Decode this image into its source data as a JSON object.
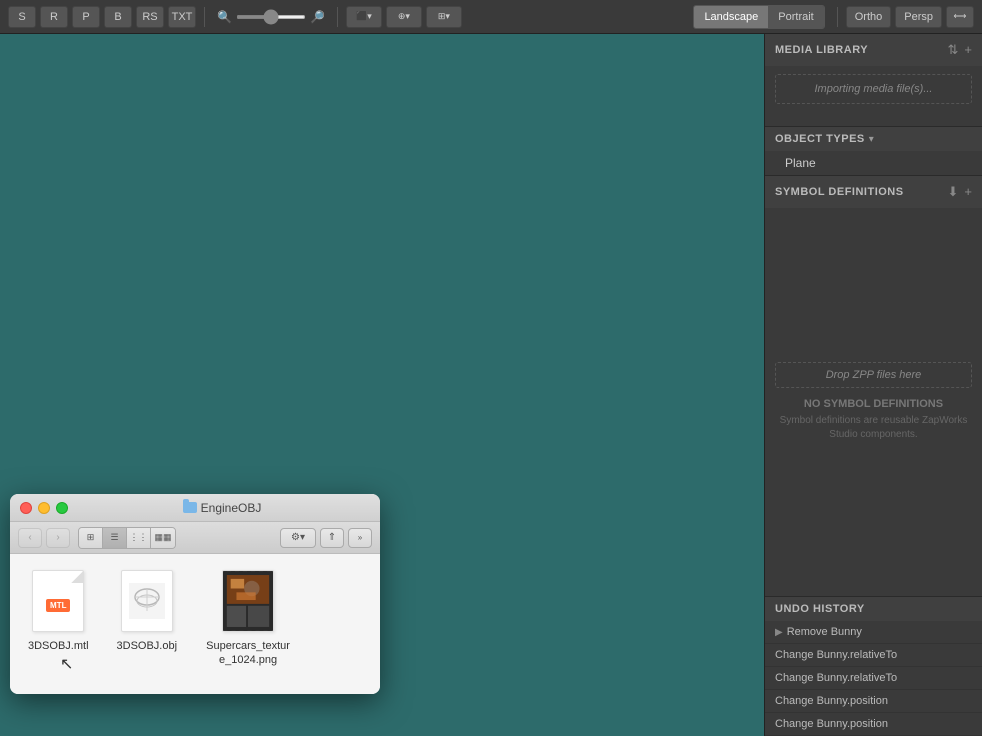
{
  "toolbar": {
    "buttons": [
      "S",
      "R",
      "P",
      "B",
      "RS",
      "TXT"
    ],
    "zoom_min_icon": "−",
    "zoom_max_icon": "+",
    "zoom_value": 50,
    "views": [
      {
        "label": "Landscape",
        "active": true
      },
      {
        "label": "Portrait",
        "active": false
      }
    ],
    "camera_buttons": [
      "Ortho",
      "Persp"
    ],
    "extra_btn": "⟷"
  },
  "right_panel": {
    "media_library": {
      "title": "MEDIA LIBRARY",
      "import_hint": "Importing media file(s)..."
    },
    "object_types": {
      "title": "OBJECT TYPES",
      "items": [
        "Plane"
      ]
    },
    "symbol_definitions": {
      "title": "SYMBOL DEFINITIONS",
      "drop_hint": "Drop ZPP files here",
      "no_symbol_title": "NO SYMBOL DEFINITIONS",
      "no_symbol_desc": "Symbol definitions are reusable ZapWorks Studio components."
    },
    "undo_history": {
      "title": "UNDO HISTORY",
      "items": [
        {
          "label": "Remove Bunny",
          "has_arrow": true
        },
        {
          "label": "Change Bunny.relativeTo",
          "has_arrow": false
        },
        {
          "label": "Change Bunny.relativeTo",
          "has_arrow": false
        },
        {
          "label": "Change Bunny.position",
          "has_arrow": false
        },
        {
          "label": "Change Bunny.position",
          "has_arrow": false
        }
      ]
    }
  },
  "file_window": {
    "title": "EngineOBJ",
    "files": [
      {
        "name": "3DSOBJ.mtl",
        "type": "mtl"
      },
      {
        "name": "3DSOBJ.obj",
        "type": "obj"
      },
      {
        "name": "Supercars_texture_1024.png",
        "type": "png"
      }
    ]
  }
}
